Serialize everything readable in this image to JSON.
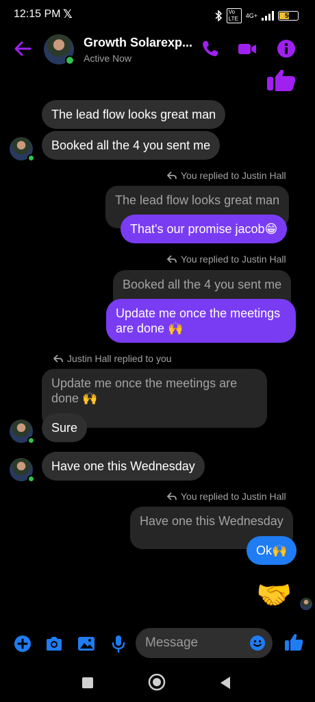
{
  "status_bar": {
    "time": "12:15 PM",
    "x_logo": "𝕏",
    "network": "4G+",
    "volte": "Vo LTE",
    "battery": "50"
  },
  "header": {
    "contact_name": "Growth Solarexp...",
    "presence": "Active Now",
    "accent_color": "#a020f0"
  },
  "messages": {
    "m1": "The lead flow looks great man",
    "m2": "Booked all the 4 you sent me",
    "reply_note_1": "You replied to Justin Hall",
    "quoted_1": "The lead flow looks great man",
    "m3": "That's our promise jacob😁",
    "reply_note_2": "You replied to Justin Hall",
    "quoted_2": "Booked all the 4 you sent me",
    "m4_line1": "Update me once the meetings",
    "m4_line2": "are done 🙌",
    "reply_note_3": "Justin Hall replied to you",
    "quoted_3_line1": "Update me once the meetings are",
    "quoted_3_line2": "done 🙌",
    "m5": "Sure",
    "m6": "Have one this Wednesday",
    "reply_note_4": "You replied to Justin Hall",
    "quoted_4": "Have one this Wednesday",
    "m7": "Ok🙌",
    "sticker": "🤝"
  },
  "composer": {
    "placeholder": "Message"
  },
  "colors": {
    "outgoing_bubble": "#7a3cf3",
    "incoming_bubble": "#2f2f2f",
    "composer_icons": "#1f7cf2"
  },
  "icons": {
    "back": "arrow-left-icon",
    "call": "phone-icon",
    "video": "video-camera-icon",
    "info": "info-icon",
    "sent_like": "thumbs-up-icon",
    "plus": "plus-circle-icon",
    "camera": "camera-icon",
    "gallery": "image-icon",
    "mic": "microphone-icon",
    "emoji": "emoji-icon",
    "like": "thumbs-up-icon"
  }
}
